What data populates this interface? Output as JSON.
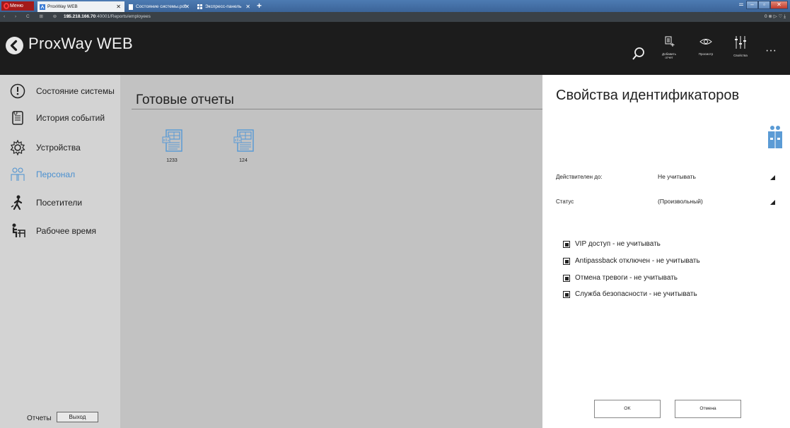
{
  "browser": {
    "menu_label": "Меню",
    "tabs": [
      {
        "title": "ProxWay WEB",
        "active": true
      },
      {
        "title": "Состояние системы.pdf",
        "active": false
      },
      {
        "title": "Экспресс-панель",
        "active": false
      }
    ],
    "new_tab": "+",
    "url_host": "195.218.166.70",
    "url_path": ":40001/Reports/employees",
    "addr_right": "0 ⊗ ▷ ♡  ⤓"
  },
  "header": {
    "title": "ProxWay WEB",
    "actions": [
      {
        "label": "Добавить отчет",
        "icon": "add-report-icon"
      },
      {
        "label": "Просмотр",
        "icon": "eye-icon"
      },
      {
        "label": "Свойства",
        "icon": "sliders-icon"
      }
    ],
    "more": "···"
  },
  "sidebar": {
    "items": [
      {
        "label": "Состояние системы",
        "icon": "gauge-icon",
        "active": false
      },
      {
        "label": "История событий",
        "icon": "history-icon",
        "active": false
      },
      {
        "label": "Устройства",
        "icon": "gear-icon",
        "active": false
      },
      {
        "label": "Персонал",
        "icon": "staff-icon",
        "active": true
      },
      {
        "label": "Посетители",
        "icon": "walker-icon",
        "active": false
      },
      {
        "label": "Рабочее время",
        "icon": "worktime-icon",
        "active": false
      }
    ],
    "reports_label": "Отчеты",
    "exit_label": "Выход"
  },
  "main": {
    "title": "Готовые отчеты",
    "reports": [
      {
        "name": "1233"
      },
      {
        "name": "124"
      }
    ]
  },
  "panel": {
    "title": "Свойства идентификаторов",
    "fields": [
      {
        "label": "Действителен до:",
        "value": "Не учитывать"
      },
      {
        "label": "Статус",
        "value": "(Произвольный)"
      }
    ],
    "checkboxes": [
      {
        "label": "VIP доступ - не учитывать"
      },
      {
        "label": "Antipassback отключен - не учитывать"
      },
      {
        "label": "Отмена тревоги - не учитывать"
      },
      {
        "label": "Служба безопасности - не учитывать"
      }
    ],
    "ok_label": "OK",
    "cancel_label": "Отмена"
  },
  "colors": {
    "accent": "#4a90d0",
    "header_bg": "#1c1c1c",
    "sidebar_bg": "#d3d3d3",
    "main_bg": "#c2c2c2",
    "report_icon": "#5b9bd5"
  }
}
